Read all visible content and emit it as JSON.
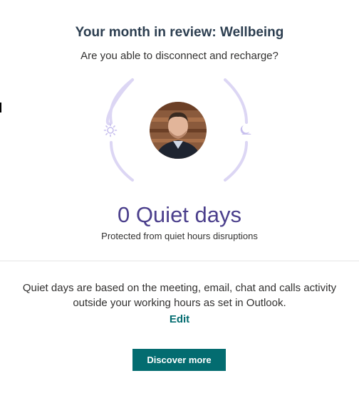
{
  "header": {
    "title": "Your month in review: Wellbeing",
    "subtitle": "Are you able to disconnect and recharge?"
  },
  "illustration": {
    "left_icon": "sun-icon",
    "right_icon": "moon-icon",
    "avatar": "user-avatar",
    "arc_color": "#dcd6f4"
  },
  "stat": {
    "value_label": "0 Quiet days",
    "caption": "Protected from quiet hours disruptions"
  },
  "info": {
    "text": "Quiet days are based on the meeting, email, chat and calls activity outside your working hours as set in Outlook.",
    "edit_label": "Edit"
  },
  "actions": {
    "discover_label": "Discover more"
  },
  "colors": {
    "accent": "#036c70",
    "stat_text": "#4b3f8c"
  }
}
